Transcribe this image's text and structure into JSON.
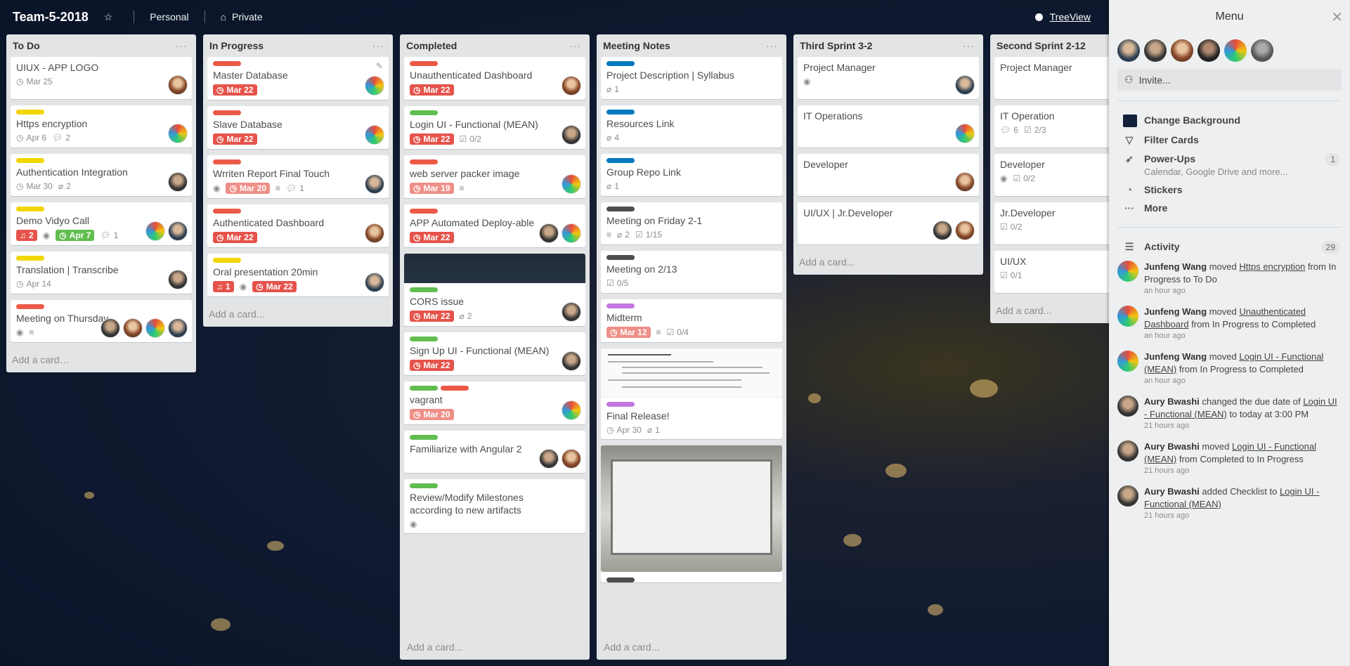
{
  "header": {
    "board_title": "Team-5-2018",
    "team": "Personal",
    "visibility": "Private",
    "treeview": "TreeView"
  },
  "lists": [
    {
      "title": "To Do",
      "add_card": "Add a card…",
      "cards": [
        {
          "title": "UIUX - APP LOGO",
          "date": "Mar 25"
        },
        {
          "title": "Https encryption",
          "date": "Apr 6",
          "comments": "2"
        },
        {
          "title": "Authentication Integration",
          "date": "Mar 30",
          "attachments": "2"
        },
        {
          "title": "Demo Vidyo Call",
          "notifications": "2",
          "due": "Apr 7",
          "comments": "1"
        },
        {
          "title": "Translation | Transcribe",
          "date": "Apr 14"
        },
        {
          "title": "Meeting on Thursday"
        }
      ]
    },
    {
      "title": "In Progress",
      "add_card": "Add a card...",
      "cards": [
        {
          "title": "Master Database",
          "due": "Mar 22"
        },
        {
          "title": "Slave Database",
          "due": "Mar 22"
        },
        {
          "title": "Wrriten Report Final Touch",
          "due": "Mar 20",
          "comments": "1"
        },
        {
          "title": "Authenticated Dashboard",
          "due": "Mar 22"
        },
        {
          "title": "Oral presentation 20min",
          "notifications": "1",
          "due": "Mar 22"
        }
      ]
    },
    {
      "title": "Completed",
      "add_card": "Add a card...",
      "cards": [
        {
          "title": "Unauthenticated Dashboard",
          "due": "Mar 22"
        },
        {
          "title": "Login UI - Functional (MEAN)",
          "due": "Mar 22",
          "checklist": "0/2"
        },
        {
          "title": "web server packer image",
          "due": "Mar 19"
        },
        {
          "title": "APP Automated Deploy-able",
          "due": "Mar 22"
        },
        {
          "title": "CORS issue",
          "due": "Mar 22",
          "attachments": "2"
        },
        {
          "title": "Sign Up UI - Functional (MEAN)",
          "due": "Mar 22"
        },
        {
          "title": "vagrant",
          "due": "Mar 20"
        },
        {
          "title": "Familiarize with Angular 2"
        },
        {
          "title": "Review/Modify Milestones according to new artifacts"
        }
      ]
    },
    {
      "title": "Meeting Notes",
      "add_card": "Add a card...",
      "cards": [
        {
          "title": "Project Description | Syllabus",
          "attachments": "1"
        },
        {
          "title": "Resources Link",
          "attachments": "4"
        },
        {
          "title": "Group Repo Link",
          "attachments": "1"
        },
        {
          "title": "Meeting on Friday 2-1",
          "attachments": "2",
          "checklist": "1/15"
        },
        {
          "title": "Meeting on 2/13",
          "checklist": "0/5"
        },
        {
          "title": "Midterm",
          "due": "Mar 12",
          "checklist": "0/4"
        },
        {
          "title": "Final Release!",
          "date": "Apr 30",
          "attachments": "1"
        }
      ]
    },
    {
      "title": "Third Sprint 3-2",
      "add_card": "Add a card...",
      "cards": [
        {
          "title": "Project Manager"
        },
        {
          "title": "IT Operations"
        },
        {
          "title": "Developer"
        },
        {
          "title": "UI/UX | Jr.Developer"
        }
      ]
    },
    {
      "title": "Second Sprint 2-12",
      "add_card": "Add a card...",
      "cards": [
        {
          "title": "Project Manager"
        },
        {
          "title": "IT Operation",
          "comments": "6",
          "checklist": "2/3"
        },
        {
          "title": "Developer",
          "checklist": "0/2"
        },
        {
          "title": "Jr.Developer",
          "checklist": "0/2"
        },
        {
          "title": "UI/UX",
          "checklist": "0/1"
        }
      ]
    }
  ],
  "sidebar": {
    "title": "Menu",
    "invite": "Invite...",
    "items": {
      "change_background": "Change Background",
      "filter_cards": "Filter Cards",
      "power_ups": "Power-Ups",
      "power_ups_sub": "Calendar, Google Drive and more...",
      "power_ups_count": "1",
      "stickers": "Stickers",
      "more": "More"
    },
    "activity_title": "Activity",
    "activity_count": "29",
    "activity": [
      {
        "user": "Junfeng Wang",
        "pre": "moved",
        "link": "Https encryption",
        "post": "from In Progress to To Do",
        "time": "an hour ago"
      },
      {
        "user": "Junfeng Wang",
        "pre": "moved",
        "link": "Unauthenticated Dashboard",
        "post": "from In Progress to Completed",
        "time": "an hour ago"
      },
      {
        "user": "Junfeng Wang",
        "pre": "moved",
        "link": "Login UI - Functional (MEAN)",
        "post": "from In Progress to Completed",
        "time": "an hour ago"
      },
      {
        "user": "Aury Bwashi",
        "pre": "changed the due date of",
        "link": "Login UI - Functional (MEAN)",
        "post": "to today at 3:00 PM",
        "time": "21 hours ago"
      },
      {
        "user": "Aury Bwashi",
        "pre": "moved",
        "link": "Login UI - Functional (MEAN)",
        "post": "from Completed to In Progress",
        "time": "21 hours ago"
      },
      {
        "user": "Aury Bwashi",
        "pre": "added Checklist to",
        "link": "Login UI - Functional (MEAN)",
        "post": "",
        "time": "21 hours ago"
      }
    ]
  },
  "colors": {
    "label_red": "#eb5a46",
    "label_yellow": "#f2d600",
    "label_green": "#61bd4f",
    "label_blue": "#0079bf",
    "label_purple": "#c377e0",
    "label_black": "#4d4d4d"
  }
}
